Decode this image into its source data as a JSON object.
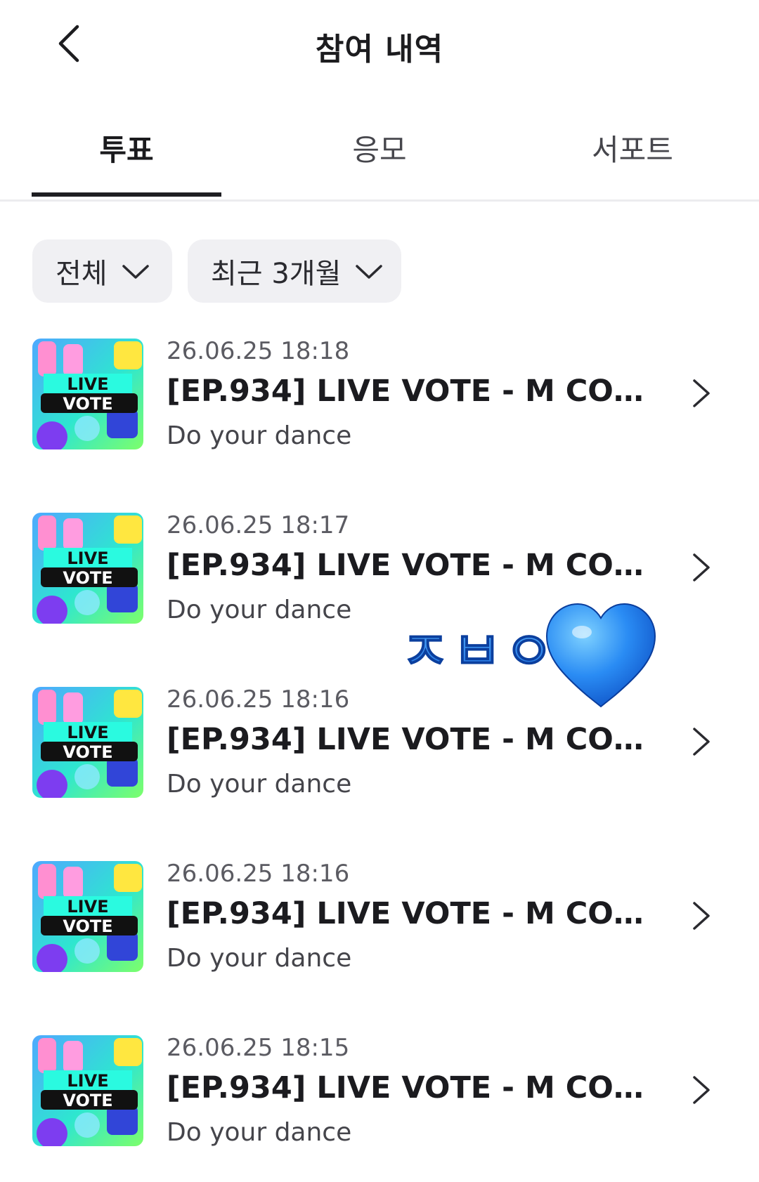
{
  "header": {
    "title": "참여 내역",
    "back_icon": "chevron-left-icon"
  },
  "tabs": [
    {
      "label": "투표",
      "active": true
    },
    {
      "label": "응모",
      "active": false
    },
    {
      "label": "서포트",
      "active": false
    }
  ],
  "filters": {
    "type": {
      "label": "전체",
      "icon": "chevron-down-icon"
    },
    "period": {
      "label": "최근 3개월",
      "icon": "chevron-down-icon"
    }
  },
  "thumbnail": {
    "line1": "LIVE",
    "line2": "VOTE"
  },
  "items": [
    {
      "date": "26.06.25 18:18",
      "title": "[EP.934] LIVE VOTE - M COUN...",
      "subtitle": "Do your dance"
    },
    {
      "date": "26.06.25 18:17",
      "title": "[EP.934] LIVE VOTE - M COUN...",
      "subtitle": "Do your dance"
    },
    {
      "date": "26.06.25 18:16",
      "title": "[EP.934] LIVE VOTE - M COUN...",
      "subtitle": "Do your dance"
    },
    {
      "date": "26.06.25 18:16",
      "title": "[EP.934] LIVE VOTE - M COUN...",
      "subtitle": "Do your dance"
    },
    {
      "date": "26.06.25 18:15",
      "title": "[EP.934] LIVE VOTE - M COUN...",
      "subtitle": "Do your dance"
    }
  ],
  "sticker": {
    "text": "ㅈㅂㅇ",
    "icon": "blue-heart-icon"
  },
  "colors": {
    "accent": "#1e1e22",
    "chip_bg": "#f0f0f3",
    "sticker_blue": "#1e7cf0"
  }
}
